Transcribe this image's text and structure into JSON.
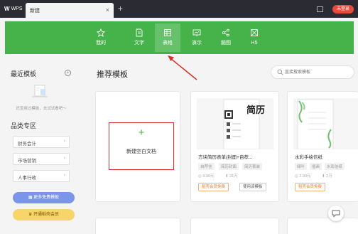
{
  "titlebar": {
    "app_name": "WPS",
    "tab_label": "新建",
    "tab_close": "×",
    "add_tab": "+",
    "login_label": "未登录"
  },
  "ribbon": {
    "items": [
      {
        "label": "我的",
        "icon": "star-icon"
      },
      {
        "label": "文字",
        "icon": "document-icon"
      },
      {
        "label": "表格",
        "icon": "spreadsheet-icon"
      },
      {
        "label": "演示",
        "icon": "presentation-icon"
      },
      {
        "label": "脑图",
        "icon": "mindmap-icon"
      },
      {
        "label": "H5",
        "icon": "image-icon"
      }
    ],
    "active_index": 2,
    "color": "#46b34a"
  },
  "sidebar": {
    "recent_title": "最近模板",
    "recent_empty": "还没用过模板，去试试看吧～",
    "categories_title": "品类专区",
    "categories": [
      "财务会计",
      "市场营销",
      "人事行政"
    ],
    "free_button": "更多免费模板",
    "vip_button": "开通稻壳会员"
  },
  "main": {
    "title": "推荐模板",
    "search_placeholder": "直接搜索模板",
    "new_blank_label": "新建空白文档",
    "templates": [
      {
        "preview_title": "简历",
        "name": "方块简历表单(封面+自荐...",
        "tags": [
          "自荐信",
          "简历封面",
          "简历套装"
        ],
        "price": "9.90元",
        "downloads": "31万",
        "vip_free_label": "稻壳会员免费",
        "use_label": "使用该模板"
      },
      {
        "name": "水彩手绘信纸",
        "tags": [
          "绿叶",
          "插画",
          "水彩信纸"
        ],
        "price": "2.90元",
        "downloads": "2万",
        "vip_free_label": "稻壳会员免费"
      }
    ]
  },
  "colors": {
    "accent_green": "#46b34a",
    "annotation_red": "#d7302a",
    "login_red": "#e94c3d"
  }
}
